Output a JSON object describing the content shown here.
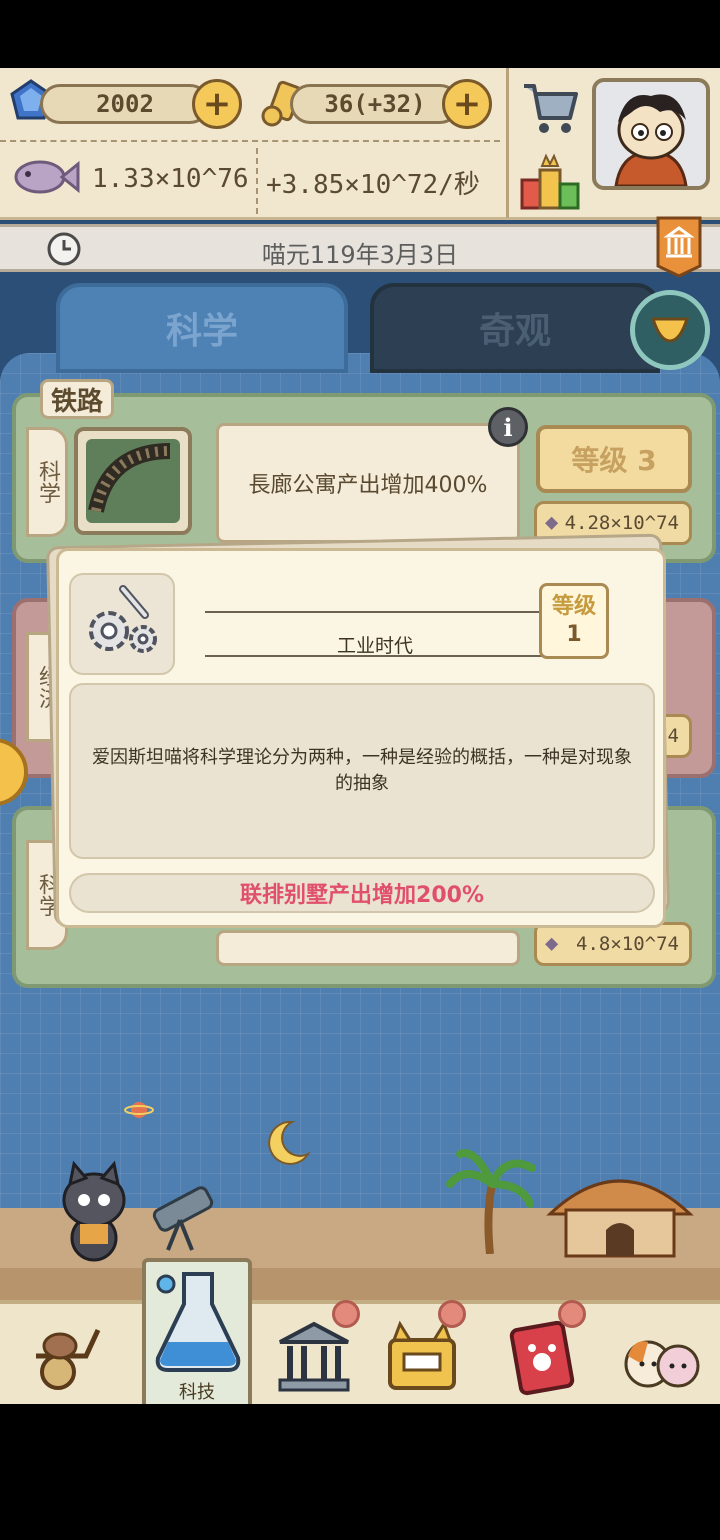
{
  "resources": {
    "gems": "2002",
    "scrolls": "36(+32)",
    "fish_total": "1.33×10^76",
    "fish_rate": "+3.85×10^72/秒"
  },
  "date": "喵元119年3月3日",
  "tabs": [
    "科学",
    "奇观"
  ],
  "cards": [
    {
      "section": "铁路",
      "side_label": "科学",
      "description": "長廊公寓产出增加400%",
      "level": "等级 3",
      "cost": "4.28×10^74"
    },
    {
      "side_label": "经济",
      "cost": "74"
    },
    {
      "side_label": "科学",
      "cost": "4.8×10^74"
    }
  ],
  "popup": {
    "title": "工业时代",
    "level_label": "等级",
    "level_value": "1",
    "quote": "爱因斯坦喵将科学理论分为两种，一种是经验的概括，一种是对现象的抽象",
    "effect": "联排别墅产出增加200%"
  },
  "nav": {
    "active_label": "科技"
  },
  "colors": {
    "background": "#2b4f76",
    "panel": "#4f7eb1",
    "parchment": "#fbf5e4",
    "effect_text": "#e0506a",
    "gold": "#f4c95a"
  }
}
